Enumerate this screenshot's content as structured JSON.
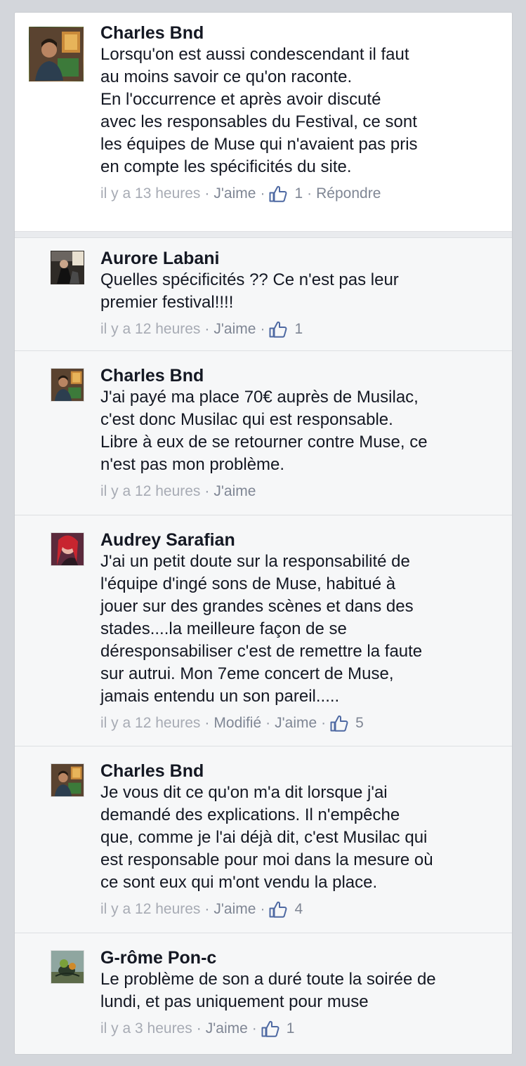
{
  "comments": [
    {
      "author": "Charles Bnd",
      "lines": [
        "Lorsqu'on est aussi condescendant il faut",
        "au moins savoir ce qu'on raconte.",
        "En l'occurrence et après avoir discuté",
        "avec les responsables du Festival, ce sont",
        "les équipes de Muse qui n'avaient pas pris",
        "en compte les spécificités du site."
      ],
      "time": "il y a 13 heures",
      "like": "J'aime",
      "likes": "1",
      "reply": "Répondre"
    },
    {
      "author": "Aurore Labani",
      "lines": [
        "Quelles spécificités ?? Ce n'est pas leur",
        "premier festival!!!!"
      ],
      "time": "il y a 12 heures",
      "like": "J'aime",
      "likes": "1"
    },
    {
      "author": "Charles Bnd",
      "lines": [
        "J'ai payé ma place 70€ auprès de Musilac,",
        "c'est donc Musilac qui est responsable.",
        "Libre à eux de se retourner contre Muse, ce",
        "n'est pas mon problème."
      ],
      "time": "il y a 12 heures",
      "like": "J'aime"
    },
    {
      "author": "Audrey Sarafian",
      "lines": [
        "J'ai un petit doute sur la responsabilité de",
        "l'équipe d'ingé sons de Muse, habitué à",
        "jouer sur des grandes scènes et dans des",
        "stades....la meilleure façon de se",
        "déresponsabiliser c'est de remettre la faute",
        "sur autrui. Mon 7eme concert de Muse,",
        "jamais entendu un son pareil....."
      ],
      "time": "il y a 12 heures",
      "edited": "Modifié",
      "like": "J'aime",
      "likes": "5"
    },
    {
      "author": "Charles Bnd",
      "lines": [
        "Je vous dit ce qu'on m'a dit lorsque j'ai",
        "demandé des explications. Il n'empêche",
        "que, comme je l'ai déjà dit, c'est Musilac qui",
        "est responsable pour moi dans la mesure où",
        "ce sont eux qui m'ont vendu la place."
      ],
      "time": "il y a 12 heures",
      "like": "J'aime",
      "likes": "4"
    },
    {
      "author": "G-rôme Pon-c",
      "lines": [
        "Le problème de son a duré toute la soirée de",
        "lundi, et pas uniquement pour muse"
      ],
      "time": "il y a 3 heures",
      "like": "J'aime",
      "likes": "1"
    }
  ],
  "separator": "·",
  "colors": {
    "background": "#d3d6db",
    "main_comment_bg": "#ffffff",
    "reply_bg": "#f6f7f8",
    "meta_text": "#9197a3",
    "like_icon": "#4e69a2"
  }
}
